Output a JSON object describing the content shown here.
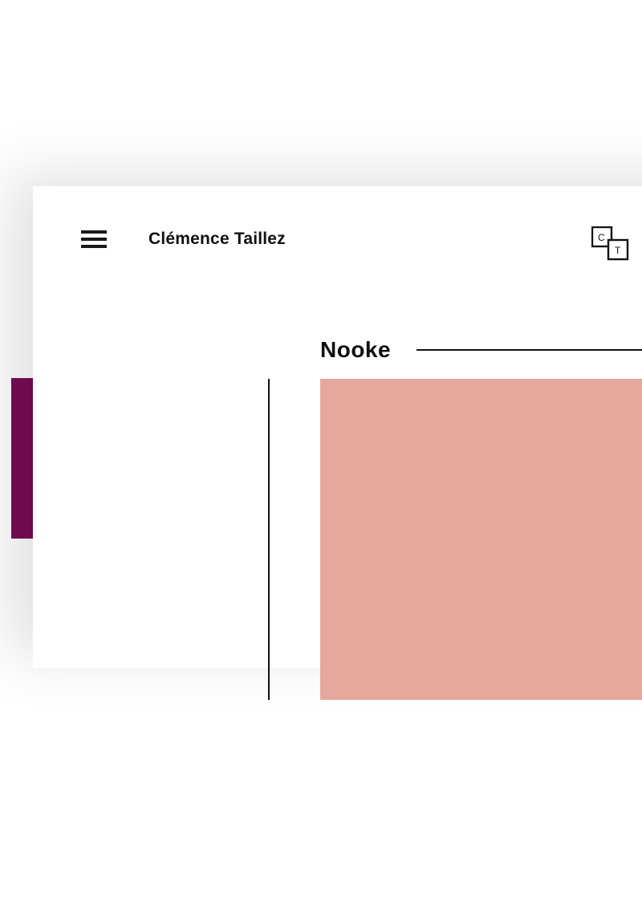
{
  "header": {
    "site_name": "Clémence Taillez",
    "logo_initials": {
      "a": "C",
      "b": "T"
    }
  },
  "project": {
    "title": "Nooke"
  },
  "colors": {
    "accent": "#7a0b55",
    "hero_bg": "#e6a79d",
    "ink": "#111111"
  }
}
